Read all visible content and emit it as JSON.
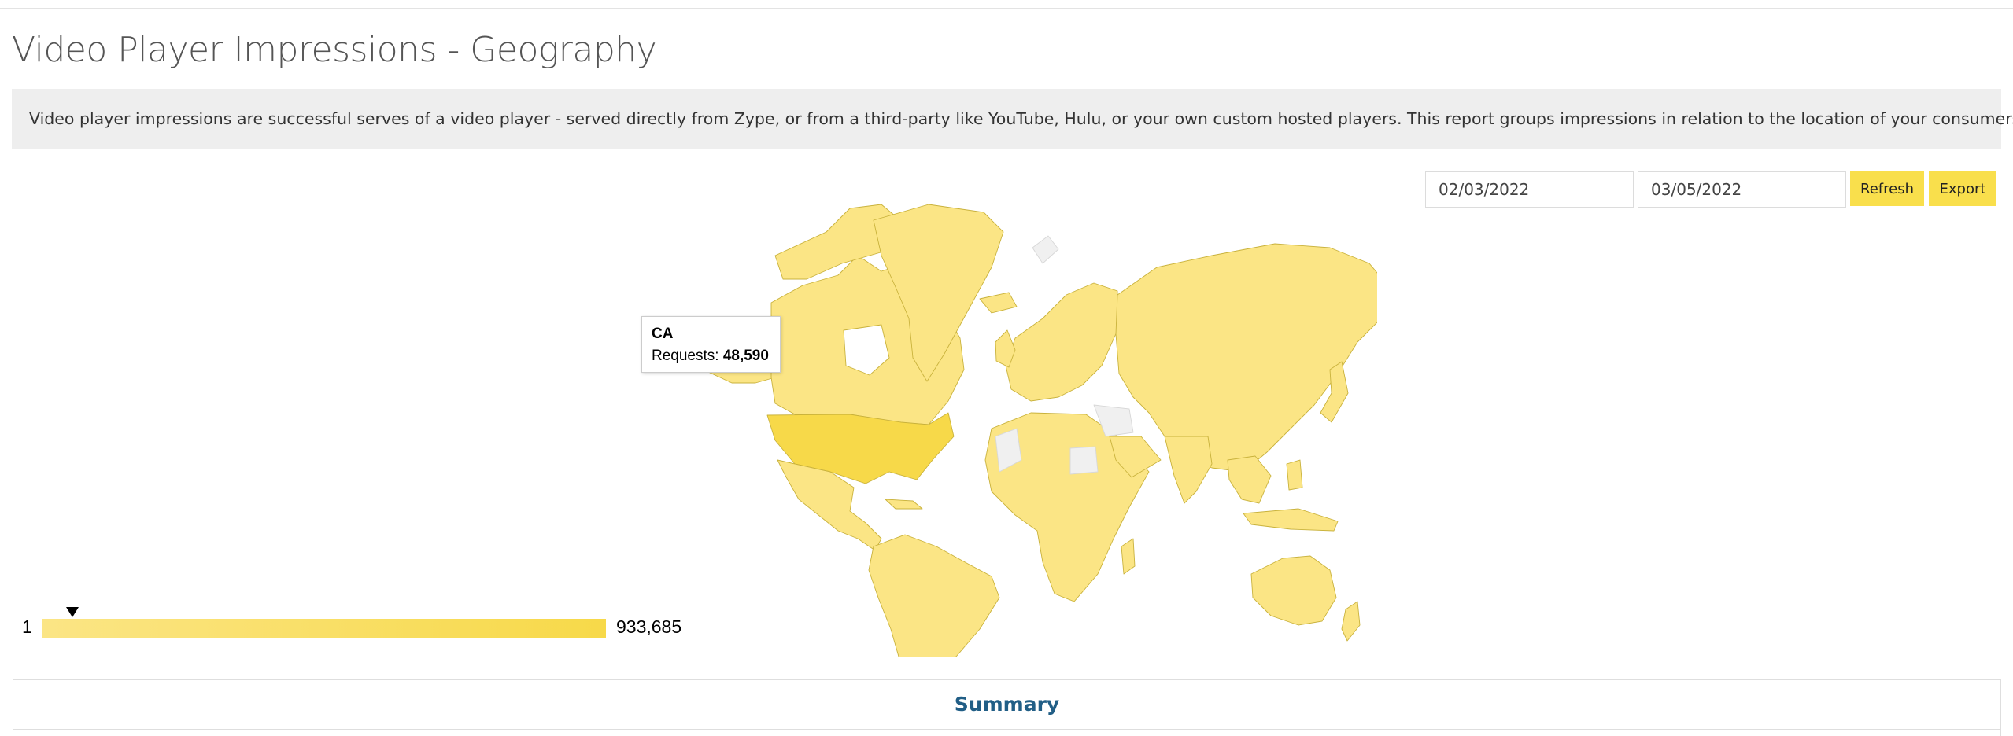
{
  "page": {
    "title": "Video Player Impressions - Geography",
    "description": "Video player impressions are successful serves of a video player - served directly from Zype, or from a third-party like YouTube, Hulu, or your own custom hosted players. This report groups impressions in relation to the location of your consumers."
  },
  "controls": {
    "start_date": "02/03/2022",
    "end_date": "03/05/2022",
    "refresh_label": "Refresh",
    "export_label": "Export"
  },
  "map": {
    "tooltip": {
      "country": "CA",
      "metric_label": "Requests:",
      "metric_value": "48,590"
    },
    "legend": {
      "min": "1",
      "max": "933,685",
      "marker_value": 48590
    },
    "colors": {
      "low": "#fbe585",
      "high": "#f7d949",
      "no_data": "#f0f0f0",
      "border": "#c9b23c"
    }
  },
  "summary": {
    "title": "Summary"
  }
}
